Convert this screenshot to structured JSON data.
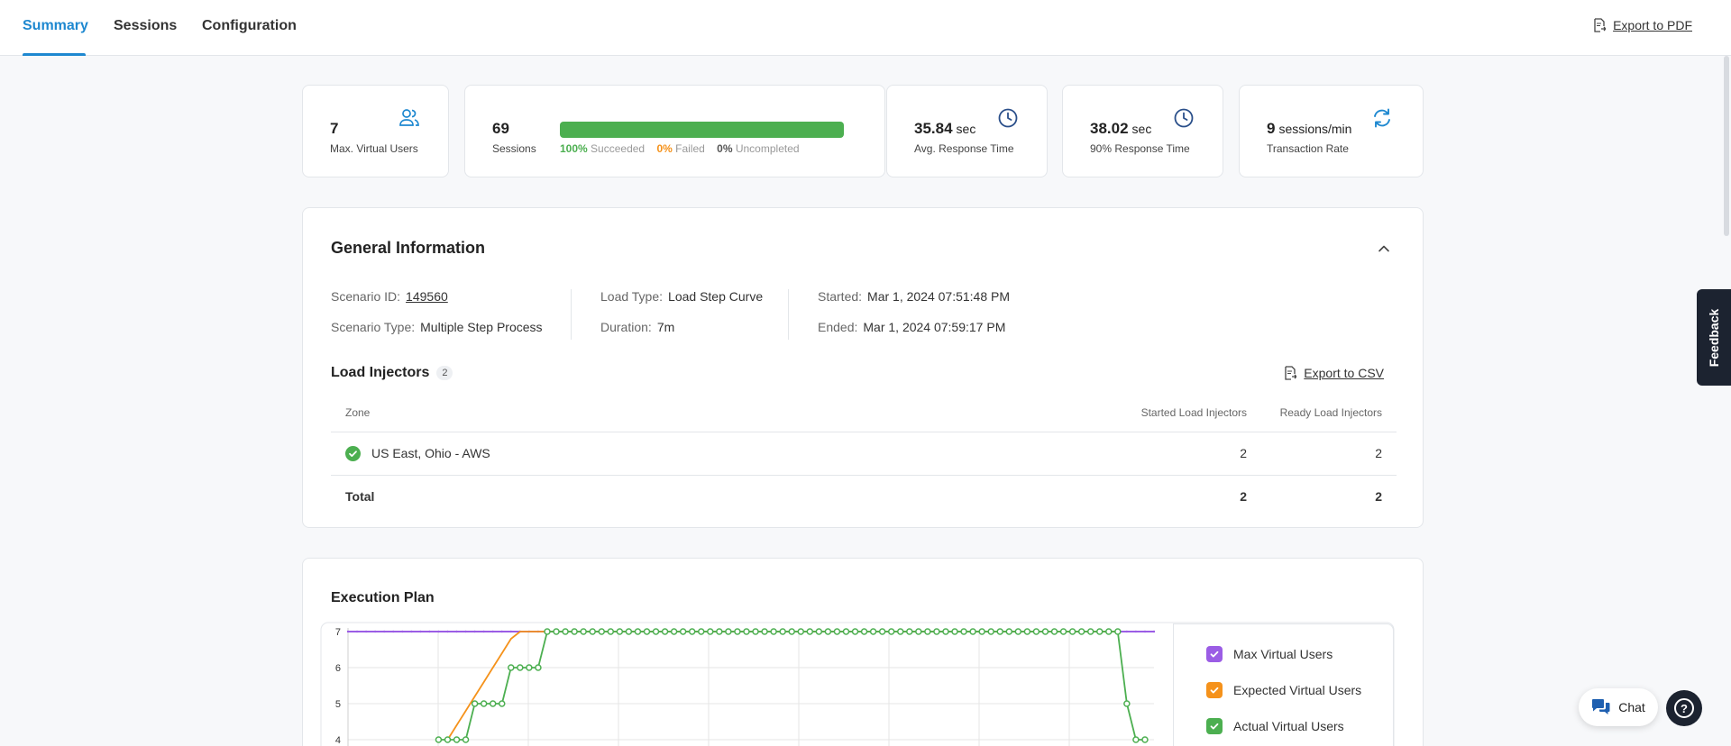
{
  "tabs": [
    {
      "label": "Summary",
      "active": true
    },
    {
      "label": "Sessions",
      "active": false
    },
    {
      "label": "Configuration",
      "active": false
    }
  ],
  "export_pdf": "Export to PDF",
  "stats": {
    "max_virtual_users": {
      "value": "7",
      "label": "Max. Virtual Users",
      "icon": "users-icon"
    },
    "sessions": {
      "value": "69",
      "label": "Sessions",
      "succeeded_pct": "100%",
      "succeeded_label": "Succeeded",
      "failed_pct": "0%",
      "failed_label": "Failed",
      "uncompleted_pct": "0%",
      "uncompleted_label": "Uncompleted",
      "success_fraction": 1.0
    },
    "avg_response": {
      "value": "35.84",
      "unit": "sec",
      "label": "Avg. Response Time",
      "icon": "clock-icon"
    },
    "p90_response": {
      "value": "38.02",
      "unit": "sec",
      "label": "90% Response Time",
      "icon": "clock-icon"
    },
    "transaction_rate": {
      "value": "9",
      "unit": "sessions/min",
      "label": "Transaction Rate",
      "icon": "refresh-icon"
    }
  },
  "general": {
    "title": "General Information",
    "scenario_id_key": "Scenario ID:",
    "scenario_id": "149560",
    "scenario_type_key": "Scenario Type:",
    "scenario_type": "Multiple Step Process",
    "load_type_key": "Load Type:",
    "load_type": "Load Step Curve",
    "duration_key": "Duration:",
    "duration": "7m",
    "started_key": "Started:",
    "started": "Mar 1, 2024 07:51:48 PM",
    "ended_key": "Ended:",
    "ended": "Mar 1, 2024 07:59:17 PM"
  },
  "injectors": {
    "title": "Load Injectors",
    "count": "2",
    "export_csv": "Export to CSV",
    "columns": [
      "Zone",
      "Started Load Injectors",
      "Ready Load Injectors"
    ],
    "rows": [
      {
        "zone": "US East, Ohio - AWS",
        "started": "2",
        "ready": "2"
      }
    ],
    "total": {
      "label": "Total",
      "started": "2",
      "ready": "2"
    }
  },
  "execution_plan": {
    "title": "Execution Plan",
    "legend": [
      {
        "label": "Max Virtual Users",
        "color": "#9b5de5"
      },
      {
        "label": "Expected Virtual Users",
        "color": "#f5921b"
      },
      {
        "label": "Actual Virtual Users",
        "color": "#4caf50"
      }
    ]
  },
  "chart_data": {
    "type": "line",
    "title": "Execution Plan",
    "xlabel": "",
    "ylabel": "",
    "y_ticks_visible": [
      7,
      6,
      5,
      4
    ],
    "ylim_visible": [
      4,
      7
    ],
    "x_points": 90,
    "grid": true,
    "legend_position": "right",
    "series": [
      {
        "name": "Max Virtual Users",
        "color": "#9b5de5",
        "values": [
          7,
          7,
          7,
          7,
          7,
          7,
          7,
          7,
          7,
          7,
          7,
          7,
          7,
          7,
          7,
          7,
          7,
          7,
          7,
          7,
          7,
          7,
          7,
          7,
          7,
          7,
          7,
          7,
          7,
          7,
          7,
          7,
          7,
          7,
          7,
          7,
          7,
          7,
          7,
          7,
          7,
          7,
          7,
          7,
          7,
          7,
          7,
          7,
          7,
          7,
          7,
          7,
          7,
          7,
          7,
          7,
          7,
          7,
          7,
          7,
          7,
          7,
          7,
          7,
          7,
          7,
          7,
          7,
          7,
          7,
          7,
          7,
          7,
          7,
          7,
          7,
          7,
          7,
          7,
          7,
          7,
          7,
          7,
          7,
          7,
          7,
          7,
          7,
          7,
          7
        ]
      },
      {
        "name": "Expected Virtual Users",
        "color": "#f5921b",
        "values": [
          null,
          null,
          null,
          null,
          null,
          null,
          null,
          null,
          null,
          null,
          null,
          4,
          4.4,
          4.8,
          5.2,
          5.6,
          6.0,
          6.4,
          6.8,
          7,
          7,
          7,
          7,
          7,
          7,
          7,
          7,
          7,
          7,
          7,
          7,
          7,
          7,
          7,
          7,
          7,
          7,
          7,
          7,
          7,
          7,
          7,
          7,
          7,
          7,
          7,
          7,
          7,
          7,
          7,
          7,
          7,
          7,
          7,
          7,
          7,
          7,
          7,
          7,
          7,
          7,
          7,
          7,
          7,
          7,
          7,
          7,
          7,
          7,
          7,
          7,
          7,
          7,
          7,
          7,
          7,
          7,
          7,
          7,
          7,
          7,
          7,
          7,
          7,
          7,
          7,
          null,
          null,
          null,
          null
        ]
      },
      {
        "name": "Actual Virtual Users",
        "color": "#4caf50",
        "values": [
          null,
          null,
          null,
          null,
          null,
          null,
          null,
          null,
          null,
          null,
          4,
          4,
          4,
          4,
          5,
          5,
          5,
          5,
          6,
          6,
          6,
          6,
          7,
          7,
          7,
          7,
          7,
          7,
          7,
          7,
          7,
          7,
          7,
          7,
          7,
          7,
          7,
          7,
          7,
          7,
          7,
          7,
          7,
          7,
          7,
          7,
          7,
          7,
          7,
          7,
          7,
          7,
          7,
          7,
          7,
          7,
          7,
          7,
          7,
          7,
          7,
          7,
          7,
          7,
          7,
          7,
          7,
          7,
          7,
          7,
          7,
          7,
          7,
          7,
          7,
          7,
          7,
          7,
          7,
          7,
          7,
          7,
          7,
          7,
          7,
          7,
          5,
          4,
          4,
          null
        ]
      }
    ]
  },
  "feedback": "Feedback",
  "chat": "Chat",
  "help": "?",
  "icons": {
    "export": "export-doc-icon",
    "check": "check-circle-icon",
    "chat": "chat-bubbles-icon",
    "help": "help-icon"
  }
}
